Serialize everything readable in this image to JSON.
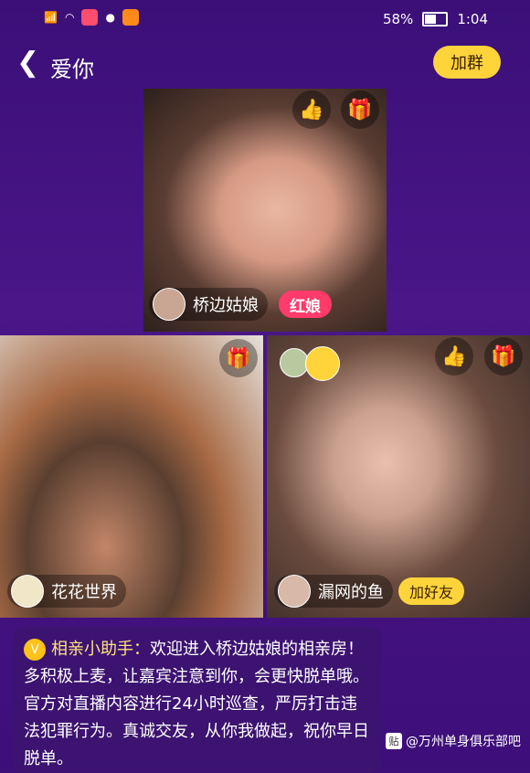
{
  "status_bar": {
    "battery": "58%",
    "time": "1:04"
  },
  "header": {
    "title": "爱你",
    "join_group": "加群"
  },
  "tiles": {
    "top": {
      "name": "桥边姑娘",
      "badge": "红娘"
    },
    "left": {
      "name": "花花世界"
    },
    "right": {
      "name": "漏网的鱼",
      "action": "加好友"
    }
  },
  "chat": {
    "sender": "相亲小助手：",
    "message": "欢迎进入桥边姑娘的相亲房！多积极上麦，让嘉宾注意到你，会更快脱单哦。官方对直播内容进行24小时巡查，严厉打击违法犯罪行为。真诚交友，从你我做起，祝你早日脱单。"
  },
  "watermark": {
    "icon_text": "贴",
    "text": "@万州单身俱乐部吧"
  },
  "colors": {
    "background": "#3b0f78",
    "accent_yellow": "#ffd43b",
    "badge_red": "#ff3b6b"
  }
}
